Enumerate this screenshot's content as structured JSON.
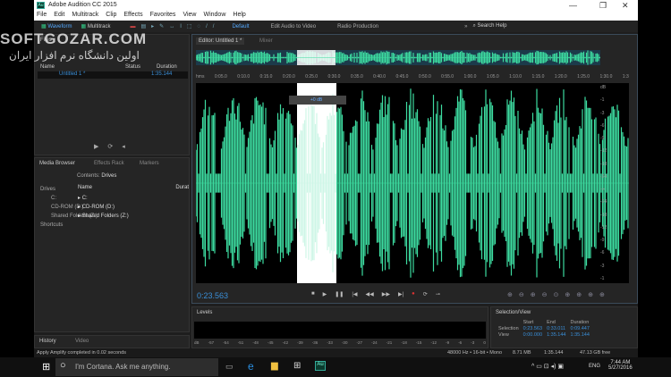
{
  "window": {
    "title": "Adobe Audition CC 2015",
    "minimize": "—",
    "restore": "❐",
    "close": "✕"
  },
  "menu": [
    "File",
    "Edit",
    "Multitrack",
    "Clip",
    "Effects",
    "Favorites",
    "View",
    "Window",
    "Help"
  ],
  "toolbar": {
    "waveform": "Waveform",
    "multitrack": "Multitrack",
    "workspaces": [
      "Default",
      "Edit Audio to Video",
      "Radio Production"
    ],
    "more": "»",
    "search": "Search Help"
  },
  "watermark": {
    "line1": "SOFTGOZAR.COM",
    "line2": "اولین دانشگاه نرم افزار ایران"
  },
  "files": {
    "tab": "Files",
    "columns": [
      "Name",
      "Status",
      "Duration"
    ],
    "rows": [
      {
        "name": "Untitled 1 *",
        "duration": "1:35.144"
      }
    ]
  },
  "media": {
    "tabs": [
      "Media Browser",
      "Effects Rack",
      "Markers"
    ],
    "contents_label": "Contents:",
    "contents_value": "Drives",
    "tree": [
      "Drives",
      "C:",
      "CD-ROM (D:)",
      "Shared Folders (Z:)",
      "Shortcuts"
    ],
    "columns": [
      "Name",
      "Durat"
    ],
    "items": [
      "C:",
      "CD-ROM (D:)",
      "Shared Folders (Z:)"
    ]
  },
  "history": {
    "tabs": [
      "History",
      "Video"
    ]
  },
  "editor": {
    "tabs": [
      "Editor: Untitled 1 *",
      "Mixer"
    ],
    "ruler": [
      "hms",
      "0:05.0",
      "0:10.0",
      "0:15.0",
      "0:20.0",
      "0:25.0",
      "0:30.0",
      "0:35.0",
      "0:40.0",
      "0:45.0",
      "0:50.0",
      "0:55.0",
      "1:00.0",
      "1:05.0",
      "1:10.0",
      "1:15.0",
      "1:20.0",
      "1:25.0",
      "1:30.0",
      "1:3"
    ],
    "db_scale": [
      "dB",
      "-1",
      "-3",
      "-6",
      "-9",
      "-12",
      "-18",
      "-24",
      "-∞",
      "-24",
      "-18",
      "-12",
      "-9",
      "-6",
      "-3",
      "-1"
    ],
    "hud_value": "+0 dB",
    "current_time": "0:23.563"
  },
  "levels": {
    "title": "Levels",
    "scale": [
      "dB",
      "-57",
      "-54",
      "-51",
      "-48",
      "-45",
      "-42",
      "-39",
      "-36",
      "-33",
      "-30",
      "-27",
      "-24",
      "-21",
      "-18",
      "-15",
      "-12",
      "-9",
      "-6",
      "-3",
      "0"
    ]
  },
  "selection_view": {
    "title": "Selection/View",
    "headers": [
      "Start",
      "End",
      "Duration"
    ],
    "rows": [
      {
        "label": "Selection",
        "start": "0:23.563",
        "end": "0:33.011",
        "duration": "0:09.447"
      },
      {
        "label": "View",
        "start": "0:00.000",
        "end": "1:35.144",
        "duration": "1:35.144"
      }
    ]
  },
  "status": {
    "left": "Apply Amplify completed in 0.02 seconds",
    "format": "48000 Hz • 16-bit • Mono",
    "size": "8.71 MB",
    "duration": "1:35.144",
    "free": "47.13 GB free"
  },
  "taskbar": {
    "cortana": "I'm Cortana. Ask me anything.",
    "lang": "ENG",
    "time": "7:44 AM",
    "date": "5/27/2016"
  },
  "colors": {
    "waveform": "#3ddba0",
    "accent": "#3a8fd8",
    "selection": "#ffffff"
  }
}
